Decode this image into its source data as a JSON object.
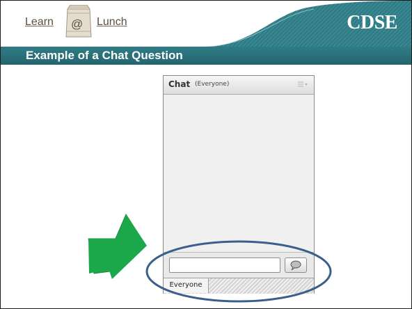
{
  "header": {
    "logo_learn": "Learn",
    "logo_at": "@",
    "logo_lunch": "Lunch",
    "brand": "CDSE"
  },
  "slide": {
    "title": "Example of a Chat Question"
  },
  "chat": {
    "title": "Chat",
    "scope": "(Everyone)",
    "menu_icon": "options-menu-icon",
    "input_value": "",
    "send_icon": "speech-bubble-icon",
    "tabs": [
      {
        "label": "Everyone",
        "selected": true
      }
    ]
  },
  "annotations": {
    "arrow_icon": "green-arrow-icon",
    "arrow_color": "#1aa84a",
    "ellipse_color": "#3b5f8c"
  },
  "colors": {
    "title_bar": "#2a707a",
    "header_swoosh": "#2f7c86"
  }
}
